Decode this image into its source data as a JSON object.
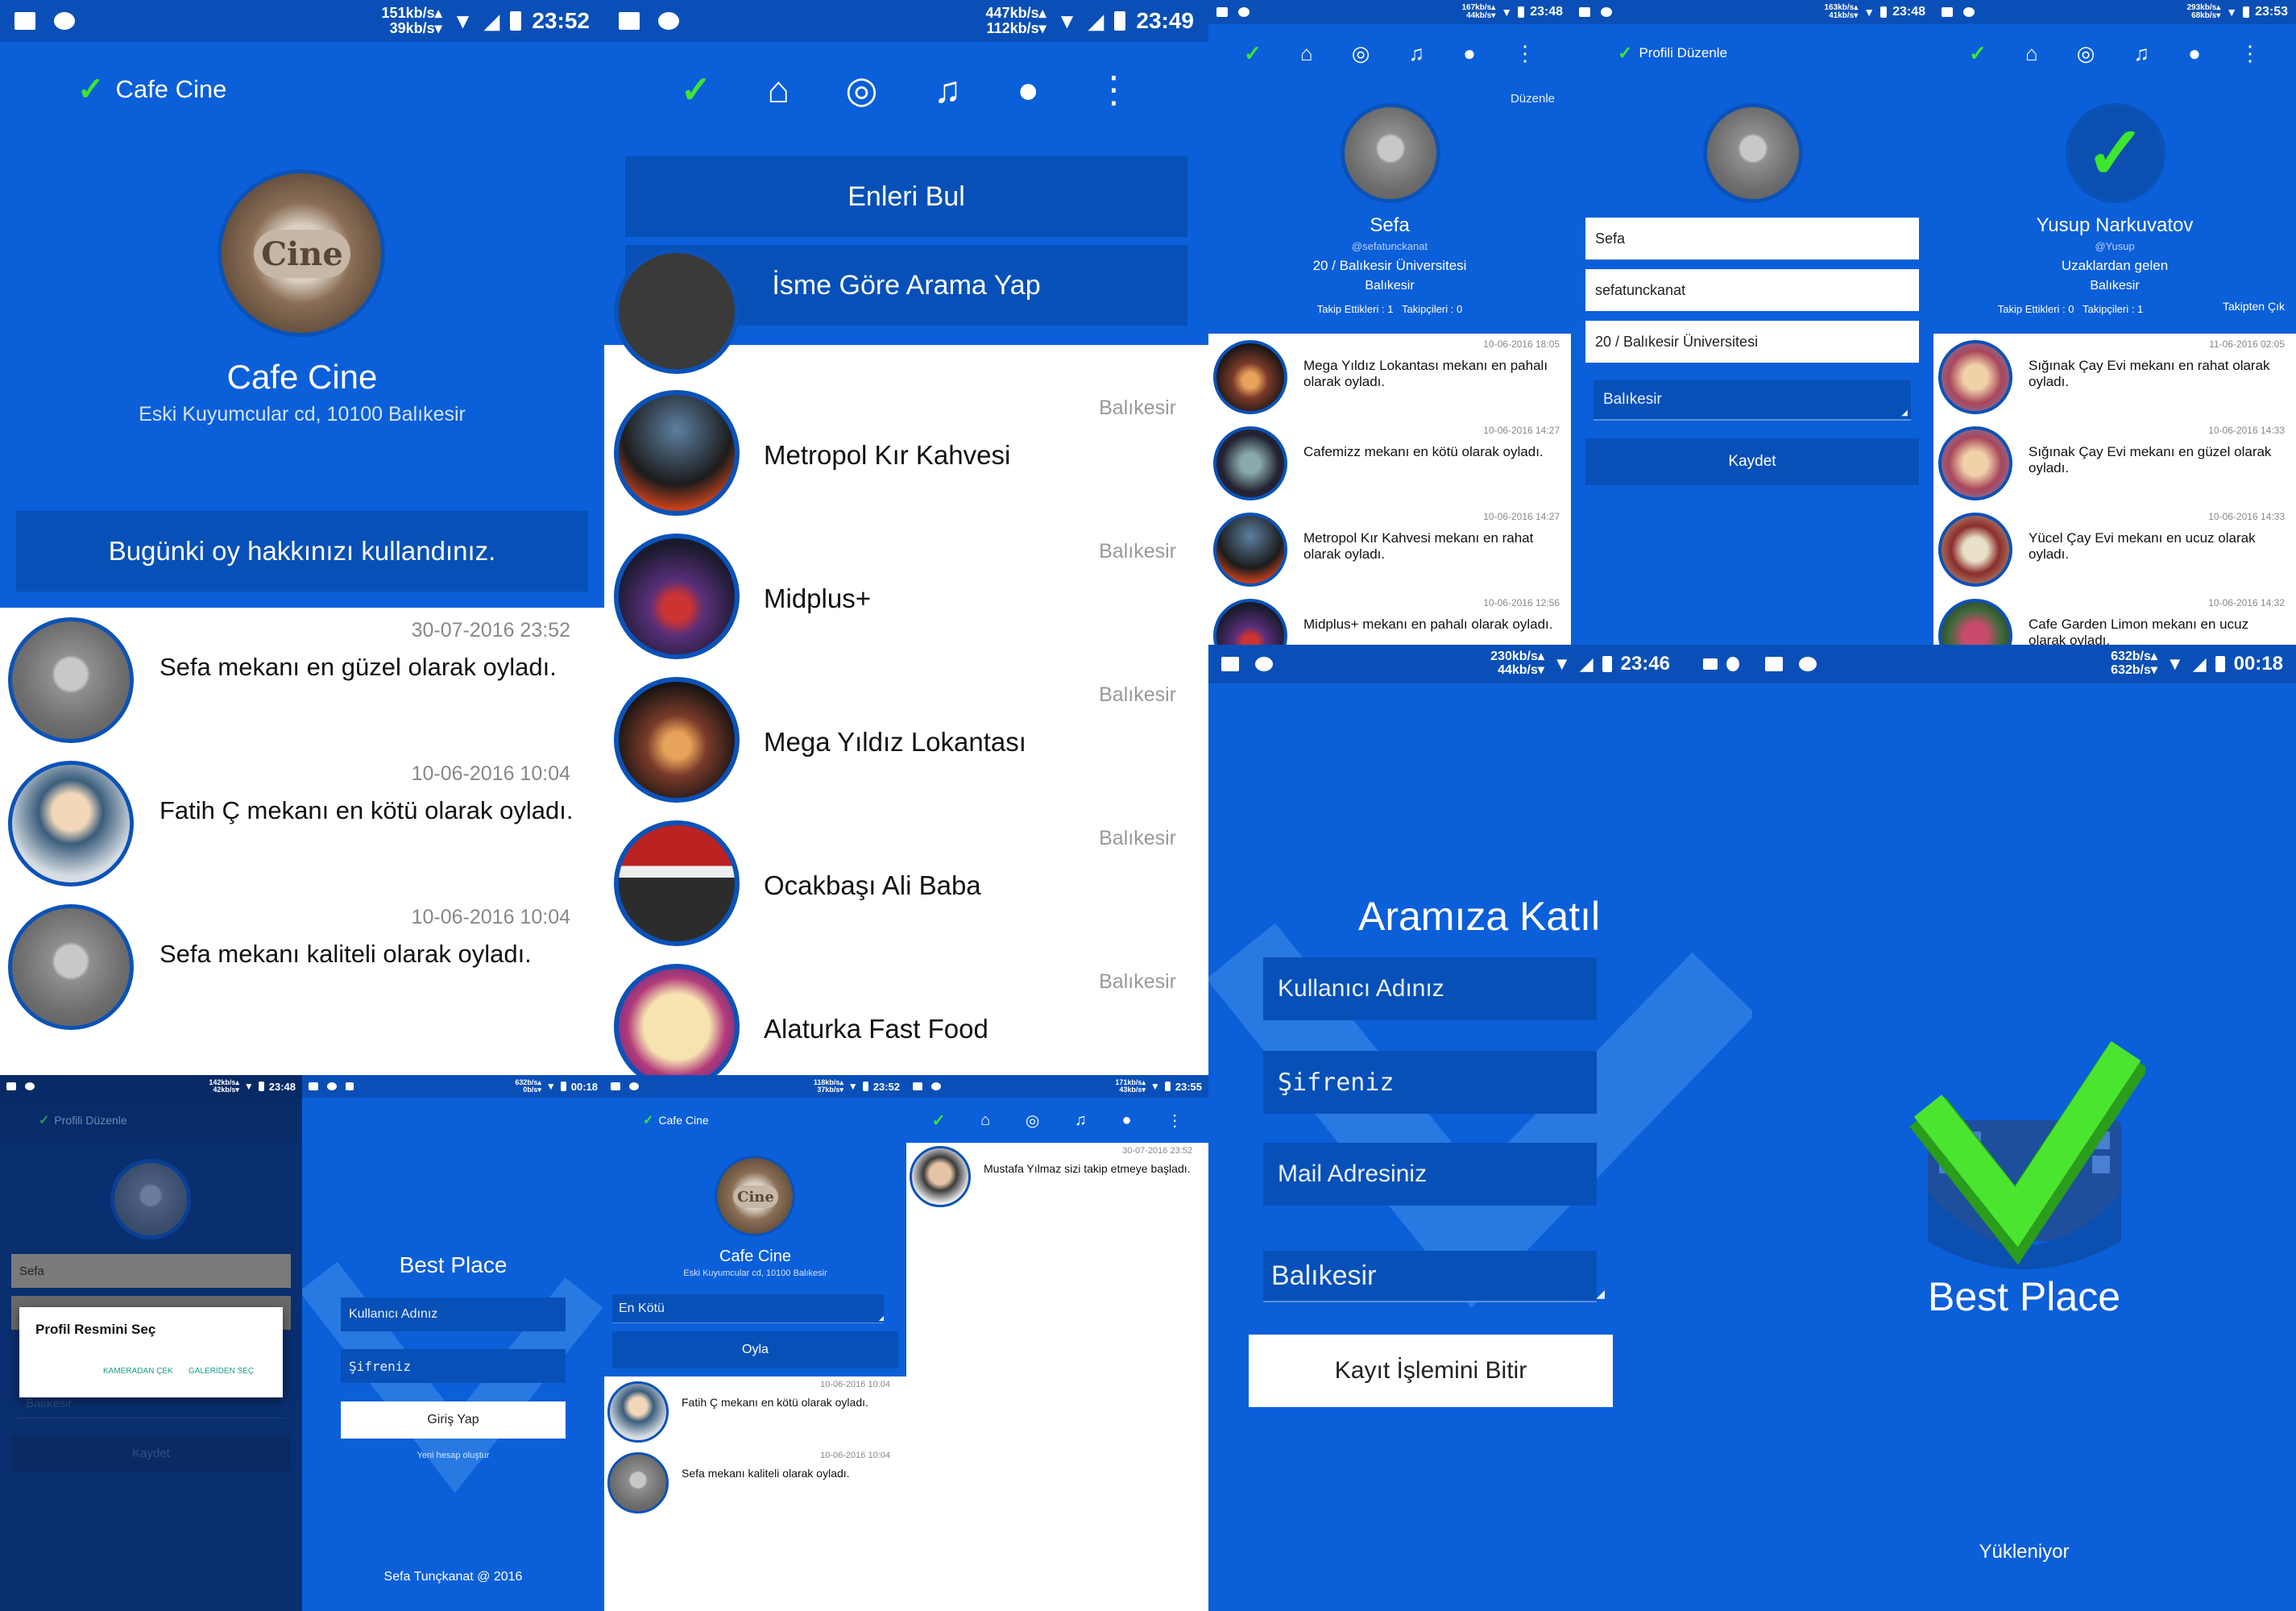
{
  "colors": {
    "primary": "#0b5fd9",
    "dark": "#0750b8",
    "status": "#0a4fb7",
    "accent": "#3ee62e"
  },
  "s1": {
    "status": {
      "speed_up": "151kb/s▴",
      "speed_down": "39kb/s▾",
      "time": "23:52"
    },
    "app_title": "Cafe Cine",
    "place_name": "Cafe Cine",
    "address": "Eski Kuyumcular cd, 10100 Balıkesir",
    "vote_button": "Bugünki oy hakkınızı kullandınız.",
    "feed": [
      {
        "date": "30-07-2016 23:52",
        "text": "Sefa mekanı en güzel olarak oyladı."
      },
      {
        "date": "10-06-2016 10:04",
        "text": "Fatih Ç mekanı en kötü olarak oyladı."
      },
      {
        "date": "10-06-2016 10:04",
        "text": "Sefa mekanı kaliteli olarak oyladı."
      }
    ]
  },
  "s2": {
    "status": {
      "speed_up": "447kb/s▴",
      "speed_down": "112kb/s▾",
      "time": "23:49"
    },
    "find_best": "Enleri Bul",
    "search_name": "İsme Göre Arama Yap",
    "places": [
      {
        "name": "Metropol Kır Kahvesi",
        "city": "Balıkesir"
      },
      {
        "name": "Midplus+",
        "city": "Balıkesir"
      },
      {
        "name": "Mega Yıldız Lokantası",
        "city": "Balıkesir"
      },
      {
        "name": "Ocakbaşı Ali Baba",
        "city": "Balıkesir"
      },
      {
        "name": "Alaturka Fast Food",
        "city": "Balıkesir"
      }
    ]
  },
  "s3": {
    "status": {
      "speed_up": "167kb/s▴",
      "speed_down": "44kb/s▾",
      "time": "23:48"
    },
    "edit": "Düzenle",
    "name": "Sefa",
    "handle": "@sefatunckanat",
    "school": "20 / Balıkesir Üniversitesi",
    "city": "Balıkesir",
    "follow_stats": "Takip Ettikleri : 1   Takipçileri : 0",
    "feed": [
      {
        "date": "10-06-2016 18:05",
        "text": "Mega Yıldız Lokantası mekanı en pahalı olarak oyladı."
      },
      {
        "date": "10-06-2016 14:27",
        "text": "Cafemizz mekanı en kötü olarak oyladı."
      },
      {
        "date": "10-06-2016 14:27",
        "text": "Metropol Kır Kahvesi mekanı en rahat olarak oyladı."
      },
      {
        "date": "10-06-2016 12:56",
        "text": "Midplus+ mekanı en pahalı olarak oyladı."
      }
    ]
  },
  "s4": {
    "status": {
      "speed_up": "163kb/s▴",
      "speed_down": "41kb/s▾",
      "time": "23:48"
    },
    "title": "Profili Düzenle",
    "fields": [
      "Sefa",
      "sefatunckanat",
      "20 / Balıkesir Üniversitesi"
    ],
    "city": "Balıkesir",
    "save": "Kaydet"
  },
  "s5": {
    "status": {
      "speed_up": "293kb/s▴",
      "speed_down": "68kb/s▾",
      "time": "23:53"
    },
    "name": "Yusup Narkuvatov",
    "handle": "@Yusup",
    "from": "Uzaklardan gelen",
    "city": "Balıkesir",
    "follow_stats": "Takip Ettikleri : 0   Takipçileri : 1",
    "unfollow": "Takipten Çık",
    "feed": [
      {
        "date": "11-06-2016 02:05",
        "text": "Sığınak Çay Evi mekanı en rahat olarak oyladı."
      },
      {
        "date": "10-06-2016 14:33",
        "text": "Sığınak Çay Evi mekanı en güzel olarak oyladı."
      },
      {
        "date": "10-06-2016 14:33",
        "text": "Yücel Çay Evi mekanı en ucuz olarak oyladı."
      },
      {
        "date": "10-06-2016 14:32",
        "text": "Cafe Garden Limon mekanı en ucuz olarak oyladı."
      }
    ]
  },
  "s6": {
    "status": {
      "speed_up": "142kb/s▴",
      "speed_down": "42kb/s▾",
      "time": "23:48"
    },
    "title": "Profili Düzenle",
    "field": "Sefa",
    "city": "Balıkesir",
    "save": "Kaydet",
    "dialog": {
      "title": "Profil Resmini Seç",
      "camera": "KAMERADAN ÇEK",
      "gallery": "GALERİDEN SEÇ"
    }
  },
  "s7": {
    "status": {
      "speed_up": "632b/s▴",
      "speed_down": "0b/s▾",
      "time": "00:18"
    },
    "app_name": "Best Place",
    "username_ph": "Kullanıcı Adınız",
    "password_ph": "Şifreniz",
    "login": "Giriş Yap",
    "new_account": "Yeni hesap oluştur",
    "footer": "Sefa Tunçkanat @ 2016"
  },
  "s8": {
    "status": {
      "speed_up": "118kb/s▴",
      "speed_down": "37kb/s▾",
      "time": "23:52"
    },
    "app_title": "Cafe Cine",
    "place_name": "Cafe Cine",
    "address": "Eski Kuyumcular cd, 10100 Balıkesir",
    "vote_option": "En Kötü",
    "vote_button": "Oyla",
    "feed": [
      {
        "date": "10-06-2016 10:04",
        "text": "Fatih Ç mekanı en kötü olarak oyladı."
      },
      {
        "date": "10-06-2016 10:04",
        "text": "Sefa mekanı kaliteli olarak oyladı."
      }
    ]
  },
  "s9": {
    "status": {
      "speed_up": "171kb/s▴",
      "speed_down": "43kb/s▾",
      "time": "23:55"
    },
    "notif": {
      "date": "30-07-2016 23:52",
      "text": "Mustafa Yılmaz sizi takip etmeye başladı."
    }
  },
  "s10": {
    "status": {
      "speed_up": "230kb/s▴",
      "speed_down": "44kb/s▾",
      "time": "23:46"
    },
    "title": "Aramıza Katıl",
    "username_ph": "Kullanıcı Adınız",
    "password_ph": "Şifreniz",
    "email_ph": "Mail Adresiniz",
    "city": "Balıkesir",
    "submit": "Kayıt İşlemini Bitir"
  },
  "s11": {
    "status": {
      "speed_up": "632b/s▴",
      "speed_down": "632b/s▾",
      "time": "00:18"
    },
    "app_name": "Best Place",
    "loading": "Yükleniyor"
  }
}
